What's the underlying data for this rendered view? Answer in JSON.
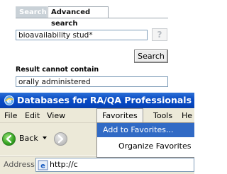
{
  "search_panel": {
    "tabs": [
      {
        "label": "Search",
        "active": false
      },
      {
        "label": "Advanced search",
        "active": true
      }
    ],
    "query_value": "bioavailability stud*",
    "help_label": "?",
    "search_button": "Search",
    "exclude_label": "Result cannot contain",
    "exclude_value": "orally administered"
  },
  "browser": {
    "title": "Databases for RA/QA Professionals -",
    "menu": [
      "File",
      "Edit",
      "View",
      "Favorites",
      "Tools",
      "He"
    ],
    "back_label": "Back",
    "address_label": "Address",
    "address_value": "http://c",
    "favorites_menu": [
      "Add to Favorites...",
      "Organize Favorites"
    ]
  },
  "colors": {
    "titlebar": "#0a4cc4",
    "menu_highlight": "#316ac5",
    "chrome": "#ece9d8"
  }
}
